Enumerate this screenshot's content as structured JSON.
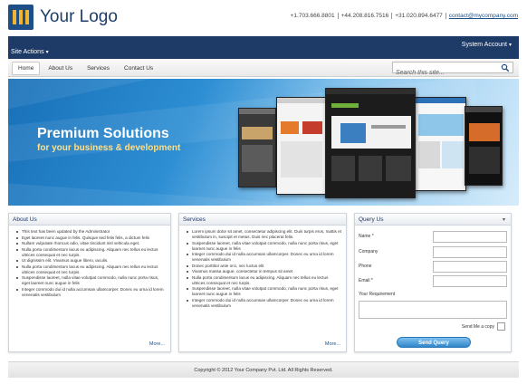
{
  "header": {
    "logo_text": "Your Logo",
    "phones": [
      "+1.703.666.8801",
      "+44.208.816.7516",
      "+31.020.894.6477"
    ],
    "email": "contact@mycompany.com"
  },
  "topbar": {
    "system_account": "System Account",
    "site_actions": "Site Actions"
  },
  "nav": {
    "tabs": [
      "Home",
      "About Us",
      "Services",
      "Contact Us"
    ],
    "active_tab": "Home",
    "search_placeholder": "Search this site..."
  },
  "banner": {
    "title": "Premium Solutions",
    "subtitle": "for your business & development"
  },
  "about": {
    "title": "About Us",
    "items": [
      "This text has been updated by the Administrator",
      "Eget laoreet nunc augue in felis. Quisque sed felis felis, a dictum felis",
      "Nullam vulputate rhoncus odio, vitae tincidunt nisl vehicula eget.",
      "Nulla porta condimentum lacus eu adipiscing. Aliquam nec tellus eu lectus ultrices consequat et nec turpis.",
      "Ut dignissim elit. Vivamus augue libero, iaculis.",
      "Nulla porta condimentum lacus eu adipiscing. Aliquam nec tellus eu lectus ultrices consequat et nec turpis.",
      "Suspendisse laoreet, nulla vitae volutpat commodo, nulla nunc porta risus, eget laoreet nunc augue in felis",
      "Integer commodo dui id nulla accumsan ullamcorper. Donec eu urna id lorem venenatis vestibulum"
    ],
    "more": "More..."
  },
  "services": {
    "title": "Services",
    "items": [
      "Lorem ipsum dolor sit amet, consectetur adipiscing elit. Duis turpis eros, mattis et vestibulum in, suscipit et metus. Duis nec placerat felis.",
      "Suspendisse laoreet, nulla vitae volutpat commodo, nulla nunc porta risus, eget laoreet nunc augue in felis",
      "Integer commodo dui id nulla accumsan ullamcorper. Donec eu urna id lorem venenatis vestibulum",
      "Donec porttitor ante orci, nec luctus elit",
      "Vivamus massa augue, consectetur in tempus sit amet",
      "Nulla porta condimentum lacus eu adipiscing. Aliquam nec tellus eu lectus ultrices consequat et nec turpis.",
      "Suspendisse laoreet, nulla vitae volutpat commodo, nulla nunc porta risus, eget laoreet nunc augue in felis",
      "Integer commodo dui id nulla accumsan ullamcorper. Donec eu urna id lorem venenatis vestibulum"
    ],
    "more": "More..."
  },
  "query": {
    "title": "Query Us",
    "name_label": "Name *",
    "company_label": "Company",
    "phone_label": "Phone",
    "email_label": "Email *",
    "requirement_label": "Your Requirement",
    "send_copy_label": "Send Me a copy",
    "submit_label": "Send Query"
  },
  "footer": {
    "copyright": "Copyright © 2012 Your Company Pvt. Ltd. All Rights Reserved."
  },
  "colors": {
    "brand_dark": "#1e3a66",
    "accent_yellow": "#ffe089",
    "button_blue": "#2f86c9"
  }
}
